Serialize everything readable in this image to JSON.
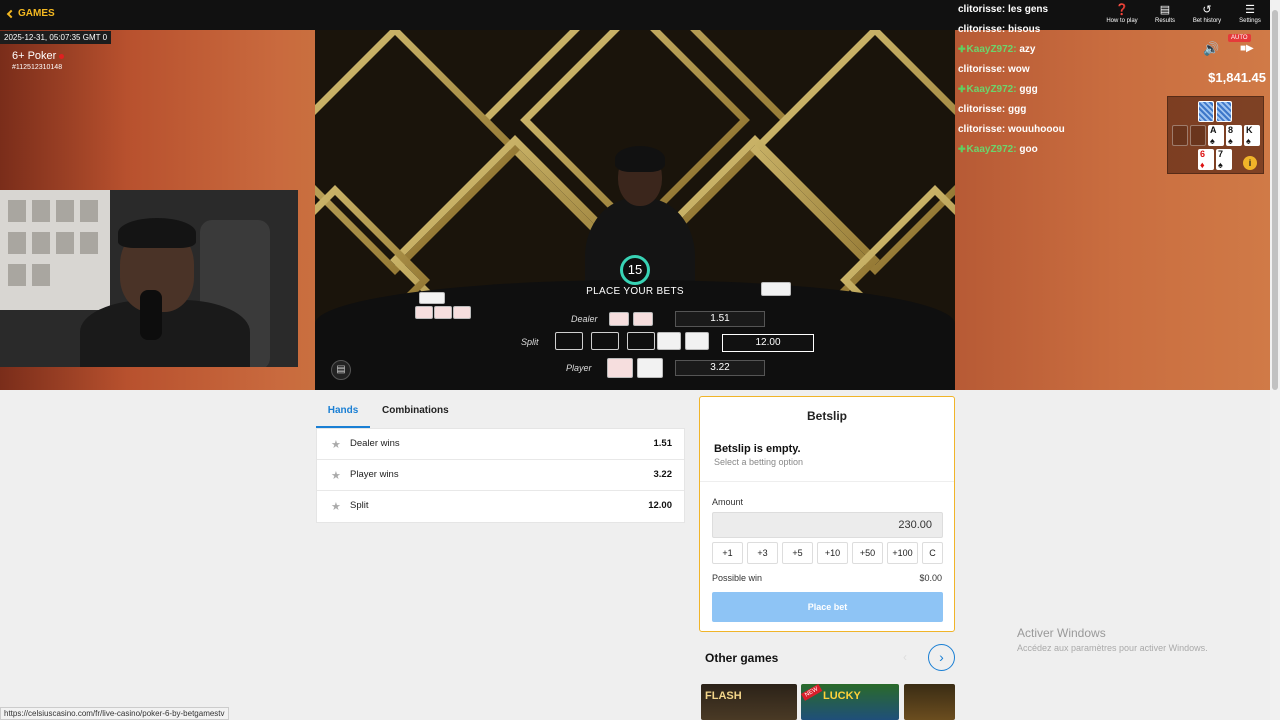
{
  "topbar": {
    "games_label": "GAMES",
    "icons": [
      {
        "name": "help-icon",
        "glyph": "❓",
        "label": "How to play"
      },
      {
        "name": "results-icon",
        "glyph": "▤",
        "label": "Results"
      },
      {
        "name": "bet-history-icon",
        "glyph": "↺",
        "label": "Bet history"
      },
      {
        "name": "settings-icon",
        "glyph": "☰",
        "label": "Settings"
      }
    ]
  },
  "stream": {
    "timestamp": "2025-12-31, 05:07:35 GMT 0",
    "game_name": "6+ Poker",
    "game_id": "#112512310148"
  },
  "dealer": {
    "timer": "15",
    "status": "PLACE YOUR BETS",
    "rows": [
      {
        "label": "Dealer",
        "odds": "1.51"
      },
      {
        "label": "Split",
        "odds": "12.00"
      },
      {
        "label": "Player",
        "odds": "3.22"
      }
    ]
  },
  "chat": {
    "messages": [
      {
        "user": "clitorisse:",
        "text": "les gens",
        "sub": false
      },
      {
        "user": "clitorisse:",
        "text": "bisous",
        "sub": false
      },
      {
        "user": "KaayZ972:",
        "text": "azy",
        "sub": true
      },
      {
        "user": "clitorisse:",
        "text": "wow",
        "sub": false
      },
      {
        "user": "KaayZ972:",
        "text": "ggg",
        "sub": true
      },
      {
        "user": "clitorisse:",
        "text": "ggg",
        "sub": false
      },
      {
        "user": "clitorisse:",
        "text": "wouuhooou",
        "sub": false
      },
      {
        "user": "KaayZ972:",
        "text": "goo",
        "sub": true
      }
    ]
  },
  "overlay": {
    "auto_badge": "AUTO",
    "balance": "$1,841.45",
    "board_cards": [
      {
        "rank": "A",
        "suit": "♠",
        "red": false
      },
      {
        "rank": "8",
        "suit": "♠",
        "red": false
      },
      {
        "rank": "K",
        "suit": "♠",
        "red": false
      },
      {
        "rank": "6",
        "suit": "♦",
        "red": true
      },
      {
        "rank": "7",
        "suit": "♠",
        "red": false
      }
    ]
  },
  "tabs": {
    "hands": "Hands",
    "combinations": "Combinations"
  },
  "bets": [
    {
      "label": "Dealer wins",
      "odds": "1.51"
    },
    {
      "label": "Player wins",
      "odds": "3.22"
    },
    {
      "label": "Split",
      "odds": "12.00"
    }
  ],
  "betslip": {
    "title": "Betslip",
    "empty_title": "Betslip is empty.",
    "empty_hint": "Select a betting option",
    "amount_label": "Amount",
    "amount_value": "230.00",
    "chips": [
      "+1",
      "+3",
      "+5",
      "+10",
      "+50",
      "+100",
      "C"
    ],
    "possible_win_label": "Possible win",
    "possible_win_value": "$0.00",
    "place_bet_label": "Place bet"
  },
  "other_games": {
    "title": "Other games",
    "games": [
      {
        "title": "FLASH",
        "badge": ""
      },
      {
        "title": "LUCKY",
        "badge": "NEW"
      },
      {
        "title": "",
        "badge": ""
      }
    ]
  },
  "windows_watermark": {
    "title": "Activer Windows",
    "subtitle": "Accédez aux paramètres pour activer Windows."
  },
  "status_bar": {
    "url": "https://celsiuscasino.com/fr/live-casino/poker-6-by-betgamestv"
  }
}
